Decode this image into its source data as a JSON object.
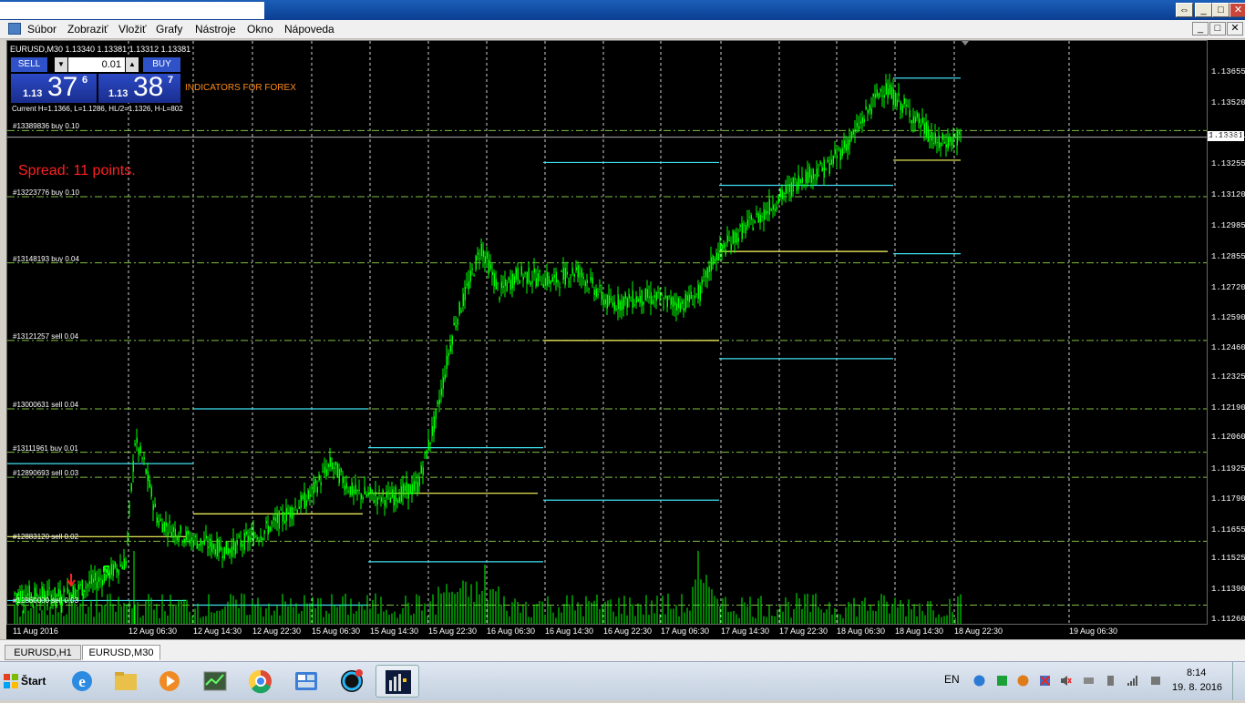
{
  "window": {
    "restore_glyph": "⇔",
    "min_glyph": "_",
    "max_glyph": "□",
    "close_glyph": "✕"
  },
  "menu": [
    "Súbor",
    "Zobraziť",
    "Vložiť",
    "Grafy",
    "Nástroje",
    "Okno",
    "Nápoveda"
  ],
  "chart": {
    "header": "EURUSD,M30  1.13340 1.13381 1.13312 1.13381",
    "indicator_banner": "INDICATORS FOR FOREX",
    "hl_info": "Current H=1.1366, L=1.1286, HL/2=1.1326, H-L=802",
    "spread": "Spread: 11 points.",
    "current_price": "1.13381",
    "colors": {
      "background": "#000000",
      "candles": "#00ff00",
      "grid": "#ffffff",
      "level_green": "#7fbf3f",
      "cyan": "#40e0f0",
      "yellow": "#ffff60",
      "spread": "#ff2020"
    },
    "order_labels": [
      {
        "text": "#13389836 buy 0.10",
        "price": 1.1341
      },
      {
        "text": "#13223776 buy 0.10",
        "price": 1.1312
      },
      {
        "text": "#13148193 buy 0.04",
        "price": 1.1283
      },
      {
        "text": "#13121257 sell 0.04",
        "price": 1.1249
      },
      {
        "text": "#13000631 sell 0.04",
        "price": 1.1219
      },
      {
        "text": "#13111961 buy 0.01",
        "price": 1.12
      },
      {
        "text": "#12890693 sell 0.03",
        "price": 1.1189
      },
      {
        "text": "#12883120 sell 0.02",
        "price": 1.1161
      },
      {
        "text": "#12860000 sell 0.03",
        "price": 1.1133
      }
    ]
  },
  "trade_panel": {
    "sell_label": "SELL",
    "buy_label": "BUY",
    "lot": "0.01",
    "sell_prefix": "1.13",
    "sell_big": "37",
    "sell_sup": "6",
    "buy_prefix": "1.13",
    "buy_big": "38",
    "buy_sup": "7"
  },
  "price_scale": [
    "1.13655",
    "1.13520",
    "1.13381",
    "1.13255",
    "1.13120",
    "1.12985",
    "1.12855",
    "1.12720",
    "1.12590",
    "1.12460",
    "1.12325",
    "1.12190",
    "1.12060",
    "1.11925",
    "1.11790",
    "1.11655",
    "1.11525",
    "1.11390",
    "1.11260"
  ],
  "time_labels": [
    "11 Aug 2016",
    "12 Aug 06:30",
    "12 Aug 14:30",
    "12 Aug 22:30",
    "15 Aug 06:30",
    "15 Aug 14:30",
    "15 Aug 22:30",
    "16 Aug 06:30",
    "16 Aug 14:30",
    "16 Aug 22:30",
    "17 Aug 06:30",
    "17 Aug 14:30",
    "17 Aug 22:30",
    "18 Aug 06:30",
    "18 Aug 14:30",
    "18 Aug 22:30",
    "19 Aug 06:30"
  ],
  "tabs": [
    "EURUSD,H1",
    "EURUSD,M30"
  ],
  "taskbar": {
    "start": "Štart",
    "lang": "EN",
    "time": "8:14",
    "date": "19. 8. 2016"
  }
}
